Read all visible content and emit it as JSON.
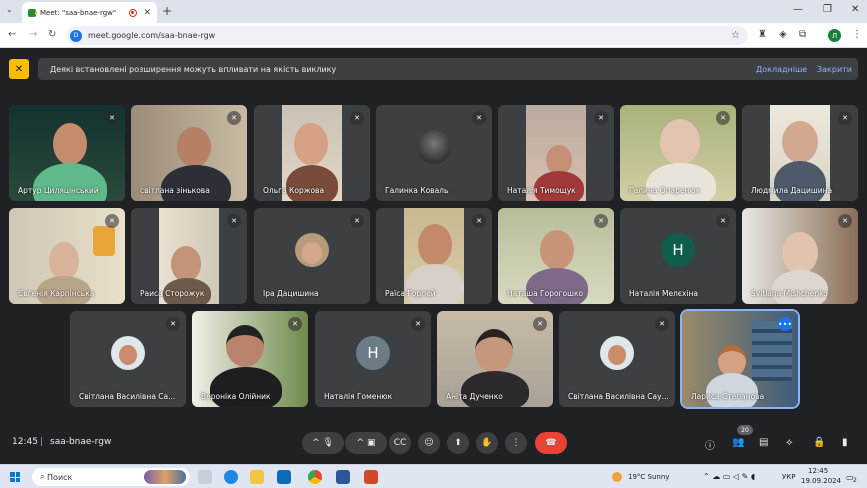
{
  "browser": {
    "tab_title": "Meet: \"saa-bnae-rgw\"",
    "url": "meet.google.com/saa-bnae-rgw",
    "profile_initial": "Л"
  },
  "banner": {
    "message": "Деякі встановлені розширення можуть впливати на якість виклику",
    "details_link": "Докладніше",
    "close_link": "Закрити"
  },
  "participants": [
    {
      "name": "Артур Циляцінський",
      "muted": true
    },
    {
      "name": "світлана зінькова",
      "muted": true
    },
    {
      "name": "Ольга Коржова",
      "muted": true
    },
    {
      "name": "Галинка Коваль",
      "muted": true
    },
    {
      "name": "Наталія Тимощук",
      "muted": true
    },
    {
      "name": "Галина Опаренюк",
      "muted": true
    },
    {
      "name": "Людмила Дацишина",
      "muted": true
    },
    {
      "name": "Євгенія Карпінська",
      "muted": true
    },
    {
      "name": "Раиса Сторожук",
      "muted": true
    },
    {
      "name": "Іра Дацишина",
      "muted": true
    },
    {
      "name": "Раїса Горпей",
      "muted": true
    },
    {
      "name": "Наташа Горогошко",
      "muted": true
    },
    {
      "name": "Наталія Мелєхіна",
      "muted": true,
      "avatar_letter": "H"
    },
    {
      "name": "Svitlana Mishchenko",
      "muted": true
    },
    {
      "name": "Світлана Василівна Са...",
      "muted": true
    },
    {
      "name": "Вероніка Олійник",
      "muted": true
    },
    {
      "name": "Наталія Гоменюк",
      "muted": true,
      "avatar_letter": "H"
    },
    {
      "name": "Аніта Дученко",
      "muted": true
    },
    {
      "name": "Світлана Василівна Сау...",
      "muted": true
    },
    {
      "name": "Лариса Степанова",
      "muted": false
    }
  ],
  "meeting": {
    "time": "12:45",
    "code": "saa-bnae-rgw",
    "participant_count": "20"
  },
  "taskbar": {
    "search_placeholder": "Поиск",
    "weather": "19°C  Sunny",
    "lang": "УКР",
    "time": "12:45",
    "date": "19.09.2024",
    "notification_count": "2"
  },
  "colors": {
    "meet_bg": "#202124",
    "tile_bg": "#3c4043",
    "end_call": "#ea4335",
    "link": "#8ab4f8",
    "avatar_green": "#0f5d4a",
    "avatar_gray": "#6b7c86"
  }
}
